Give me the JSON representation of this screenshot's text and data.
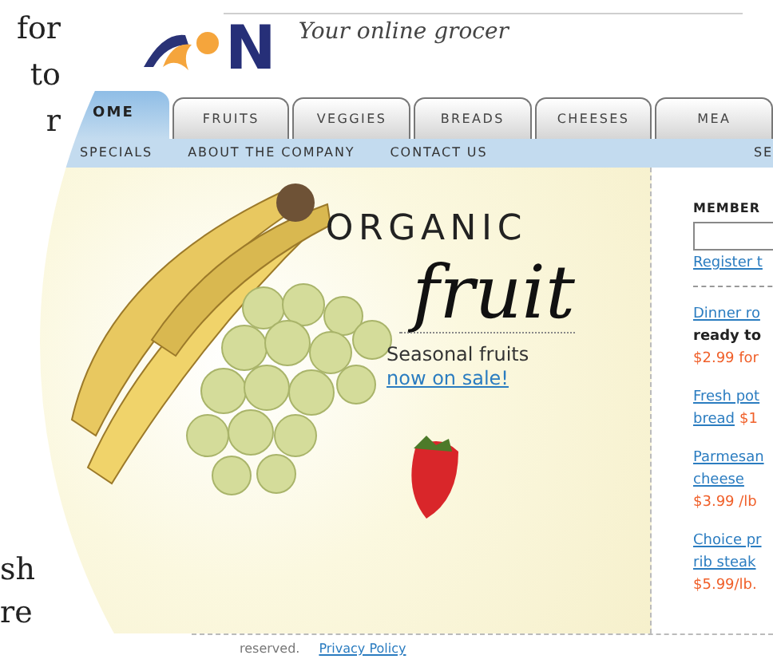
{
  "book_text": {
    "top_lines": [
      "for",
      "to",
      "r"
    ],
    "bottom_lines": [
      "sh",
      "re"
    ]
  },
  "site": {
    "logo_letter": "N",
    "tagline": "Your online grocer",
    "tabs": [
      {
        "label": "OME",
        "selected": true
      },
      {
        "label": "FRUITS",
        "selected": false
      },
      {
        "label": "VEGGIES",
        "selected": false
      },
      {
        "label": "BREADS",
        "selected": false
      },
      {
        "label": "CHEESES",
        "selected": false
      },
      {
        "label": "MEA",
        "selected": false
      }
    ],
    "subnav": [
      "SPECIALS",
      "ABOUT THE COMPANY",
      "CONTACT US"
    ],
    "subnav_right": "SE",
    "hero": {
      "heading": "ORGANIC",
      "script": "fruit",
      "subtitle": "Seasonal fruits",
      "link": "now on sale!"
    },
    "sidebar": {
      "member_label": "MEMBER",
      "register_link": "Register t",
      "products": [
        {
          "link_lines": [
            "Dinner ro"
          ],
          "note": "ready to",
          "price": "$2.99 for",
          "price_inline": false
        },
        {
          "link_lines": [
            "Fresh pot",
            "bread"
          ],
          "price": "$1",
          "price_inline": true
        },
        {
          "link_lines": [
            "Parmesan",
            "cheese"
          ],
          "price": "$3.99 /lb",
          "price_inline": false
        },
        {
          "link_lines": [
            "Choice pr",
            "rib steak"
          ],
          "price": "$5.99/lb.",
          "price_inline": false
        }
      ]
    },
    "footer": {
      "text": "reserved.",
      "link": "Privacy Policy"
    }
  }
}
